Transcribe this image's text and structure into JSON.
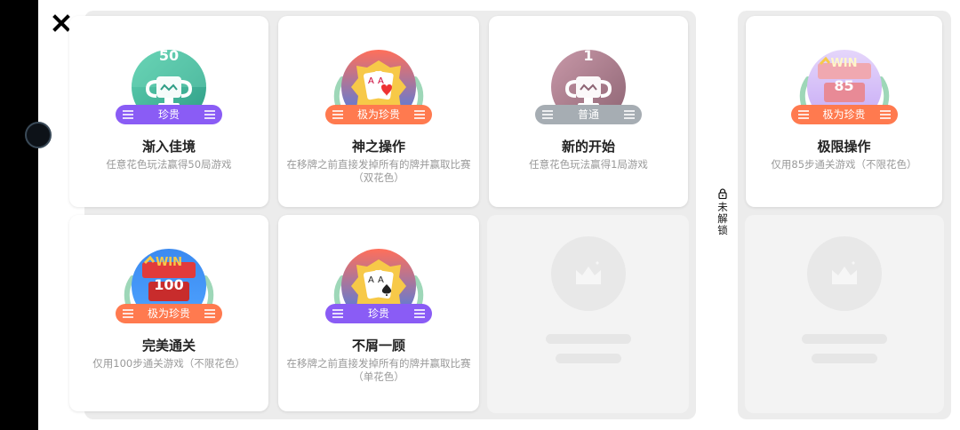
{
  "close_icon": "close-icon",
  "sections": {
    "locked_label": "未解锁"
  },
  "achievements": [
    {
      "id": "a1",
      "title": "渐入佳境",
      "desc": "任意花色玩法赢得50局游戏",
      "badge": "珍贵",
      "badge_color": "#8a5cf5",
      "medal_text": "50",
      "medal_type": "trophy-teal"
    },
    {
      "id": "a2",
      "title": "神之操作",
      "desc": "在移牌之前直接发掉所有的牌并赢取比赛（双花色）",
      "badge": "极为珍贵",
      "badge_color": "#ff7a4f",
      "medal_text": "",
      "medal_type": "cards-hearts"
    },
    {
      "id": "a3",
      "title": "新的开始",
      "desc": "任意花色玩法赢得1局游戏",
      "badge": "普通",
      "badge_color": "#a6adb3",
      "medal_text": "1",
      "medal_type": "trophy-mauve"
    },
    {
      "id": "a4",
      "title": "完美通关",
      "desc": "仅用100步通关游戏（不限花色）",
      "badge": "极为珍贵",
      "badge_color": "#ff7a4f",
      "medal_text_top": "WIN",
      "medal_text": "100",
      "medal_type": "win-blue"
    },
    {
      "id": "a5",
      "title": "不屑一顾",
      "desc": "在移牌之前直接发掉所有的牌并赢取比赛（单花色）",
      "badge": "珍贵",
      "badge_color": "#8a5cf5",
      "medal_text": "",
      "medal_type": "cards-spades"
    },
    {
      "id": "a6",
      "title": "极限操作",
      "desc": "仅用85步通关游戏（不限花色）",
      "badge": "极为珍贵",
      "badge_color": "#ff7a4f",
      "medal_text_top": "WIN",
      "medal_text": "85",
      "medal_type": "win-lilac"
    }
  ]
}
